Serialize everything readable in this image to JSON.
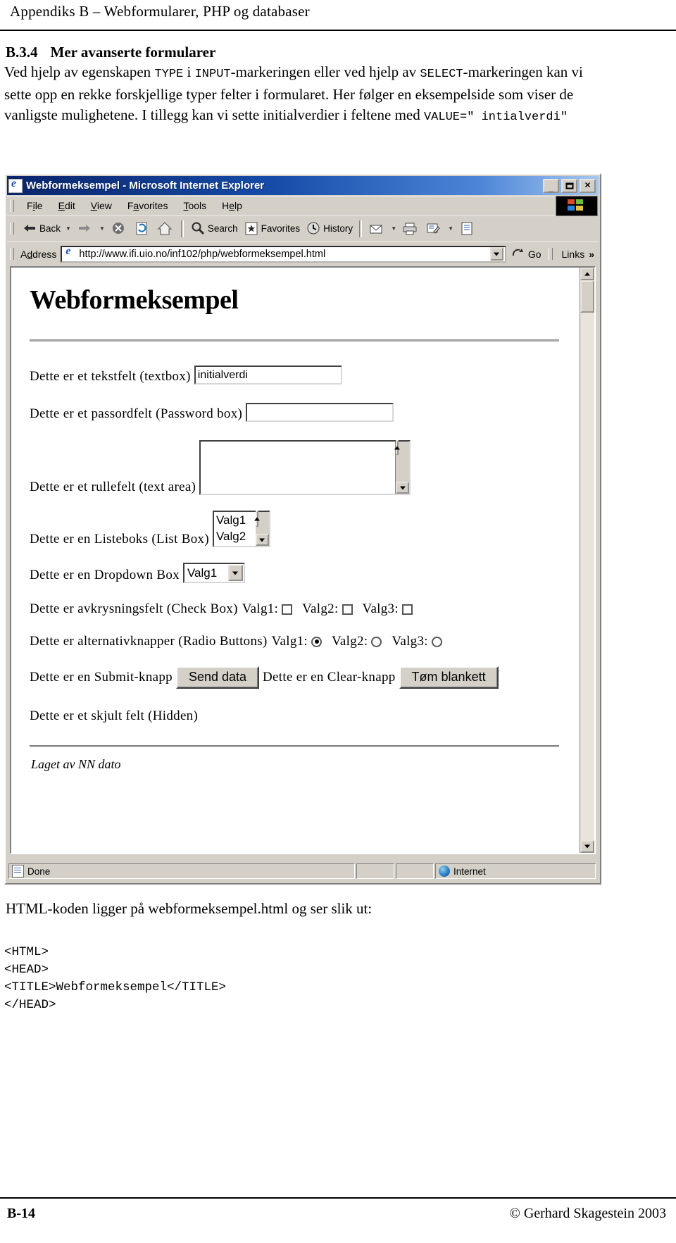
{
  "document": {
    "running_header": "Appendiks B – Webformularer, PHP og databaser",
    "section_number": "B.3.4",
    "section_title": "Mer avanserte formularer",
    "paragraph": {
      "p1": "Ved hjelp av egenskapen ",
      "code1": "TYPE",
      "p2": " i ",
      "code2": "INPUT",
      "p3": "-markeringen eller ved hjelp av ",
      "code3": "SELECT",
      "p4": "-markeringen kan vi sette opp en rekke forskjellige typer felter i formularet. Her følger en eksempelside som viser de vanligste mulighetene. I tillegg kan vi sette initialverdier i feltene med ",
      "code4": "VALUE=\" intialverdi\""
    },
    "after_browser_text": "HTML-koden ligger på webformeksempel.html og ser slik ut:",
    "code_listing": "<HTML>\n<HEAD>\n<TITLE>Webformeksempel</TITLE>\n</HEAD>",
    "footer_page": "B-14",
    "footer_copyright": "© Gerhard Skagestein 2003"
  },
  "browser": {
    "title": "Webformeksempel - Microsoft Internet Explorer",
    "window_controls": {
      "minimize": "_",
      "maximize": "□",
      "close": "✕"
    },
    "menu": [
      {
        "pre": "F",
        "key": "i",
        "post": "le"
      },
      {
        "pre": "",
        "key": "E",
        "post": "dit"
      },
      {
        "pre": "",
        "key": "V",
        "post": "iew"
      },
      {
        "pre": "F",
        "key": "a",
        "post": "vorites"
      },
      {
        "pre": "",
        "key": "T",
        "post": "ools"
      },
      {
        "pre": "H",
        "key": "e",
        "post": "lp"
      }
    ],
    "toolbar": {
      "back": "Back",
      "forward": "",
      "stop": "",
      "refresh": "",
      "home": "",
      "search": "Search",
      "favorites": "Favorites",
      "history": "History"
    },
    "address": {
      "label": "Address",
      "url": "http://www.ifi.uio.no/inf102/php/webformeksempel.html",
      "go": "Go",
      "links": "Links",
      "chevrons": "»"
    },
    "status": {
      "done": "Done",
      "zone": "Internet"
    }
  },
  "webpage": {
    "heading": "Webformeksempel",
    "fields": {
      "textbox_label": "Dette er et tekstfelt (textbox)",
      "textbox_value": "initialverdi",
      "password_label": "Dette er et passordfelt (Password box)",
      "password_value": "",
      "textarea_label": "Dette er et rullefelt (text area)",
      "textarea_value": "",
      "listbox_label": "Dette er en Listeboks (List Box)",
      "listbox_options": [
        "Valg1",
        "Valg2"
      ],
      "dropdown_label": "Dette er en Dropdown Box",
      "dropdown_value": "Valg1",
      "checkbox_label": "Dette er avkrysningsfelt (Check Box)",
      "checkbox_items": [
        "Valg1:",
        "Valg2:",
        "Valg3:"
      ],
      "radio_label": "Dette er alternativknapper (Radio Buttons)",
      "radio_items": [
        "Valg1:",
        "Valg2:",
        "Valg3:"
      ],
      "submit_label": "Dette er en Submit-knapp",
      "submit_button": "Send data",
      "clear_label": "Dette er en Clear-knapp",
      "clear_button": "Tøm blankett",
      "hidden_label": "Dette er et skjult felt (Hidden)",
      "footer": "Laget av NN dato"
    }
  }
}
